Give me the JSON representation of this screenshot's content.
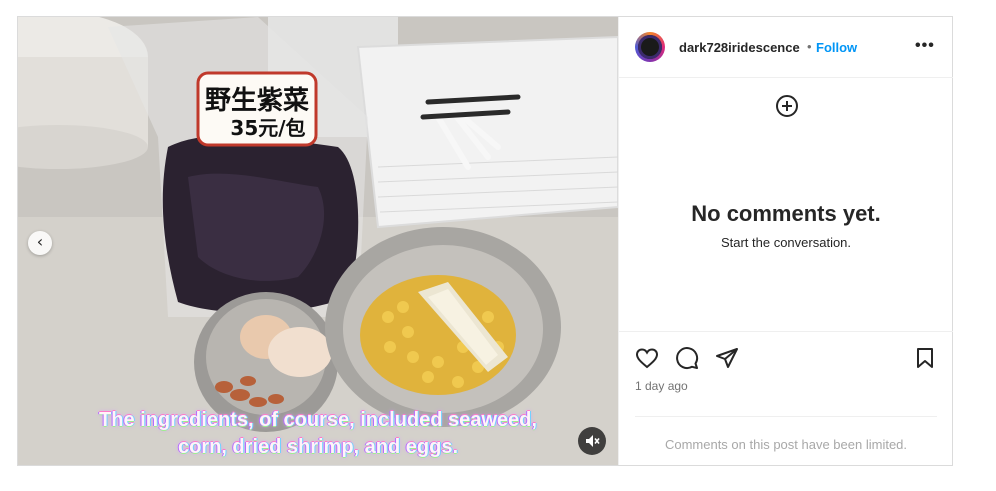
{
  "post": {
    "caption_line1": "The ingredients, of course, included seaweed,",
    "caption_line2": "corn, dried shrimp, and eggs.",
    "label_line1": "野生紫菜",
    "label_line2": "35元/包"
  },
  "header": {
    "username": "dark728iridescence",
    "separator": "•",
    "follow_label": "Follow",
    "more_label": "•••"
  },
  "comments": {
    "empty_title": "No comments yet.",
    "empty_subtitle": "Start the conversation."
  },
  "actions": {
    "timestamp": "1 day ago",
    "limited_notice": "Comments on this post have been limited."
  },
  "icons": {
    "prev": "chevron-left-icon",
    "mute": "speaker-muted-icon",
    "more": "more-horizontal-icon",
    "add": "add-circle-icon",
    "like": "heart-icon",
    "comment": "comment-icon",
    "share": "send-icon",
    "save": "bookmark-icon"
  },
  "colors": {
    "accent": "#0095f6",
    "text": "#262626",
    "muted": "#737373",
    "border": "#dbdbdb"
  }
}
